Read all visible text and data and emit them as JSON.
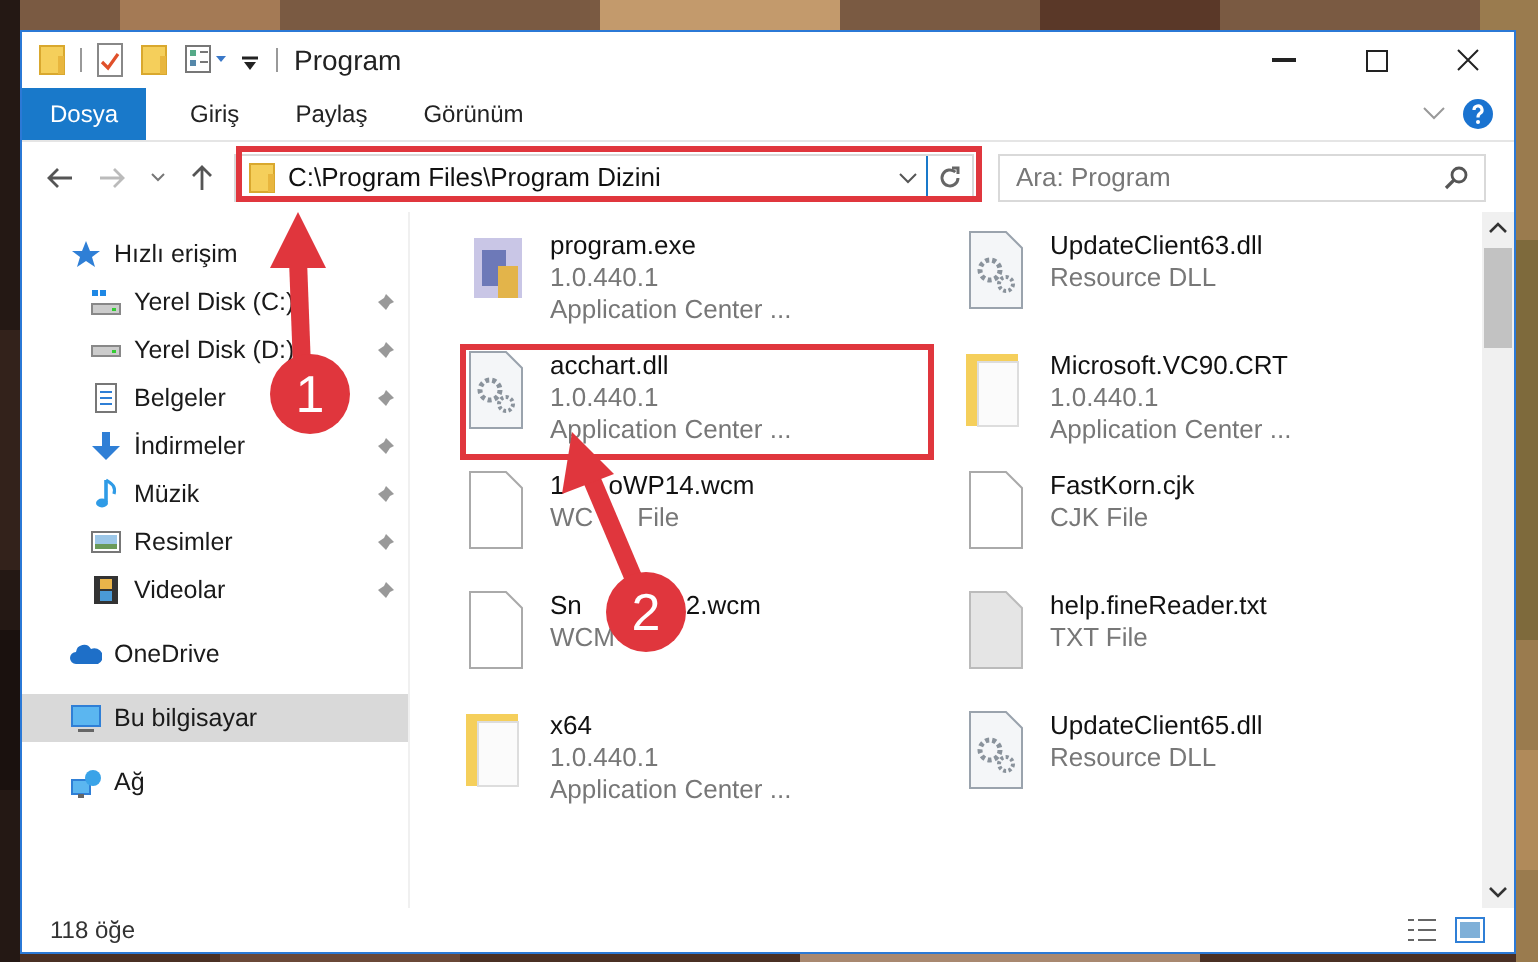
{
  "window": {
    "title": "Program"
  },
  "ribbon_tabs": [
    {
      "label": "Dosya",
      "selected": true
    },
    {
      "label": "Giriş",
      "selected": false
    },
    {
      "label": "Paylaş",
      "selected": false
    },
    {
      "label": "Görünüm",
      "selected": false
    }
  ],
  "address": {
    "path": "C:\\Program Files\\Program Dizini"
  },
  "search": {
    "placeholder": "Ara: Program"
  },
  "sidebar": {
    "items": [
      {
        "label": "Hızlı erişim",
        "kind": "star",
        "selected": false,
        "children": [
          {
            "label": "Yerel Disk (C:)",
            "kind": "windrive",
            "pinned": true
          },
          {
            "label": "Yerel Disk (D:)",
            "kind": "drive",
            "pinned": true
          },
          {
            "label": "Belgeler",
            "kind": "document",
            "pinned": true
          },
          {
            "label": "İndirmeler",
            "kind": "download",
            "pinned": true
          },
          {
            "label": "Müzik",
            "kind": "music",
            "pinned": true
          },
          {
            "label": "Resimler",
            "kind": "pictures",
            "pinned": true
          },
          {
            "label": "Videolar",
            "kind": "film",
            "pinned": true
          }
        ]
      },
      {
        "label": "OneDrive",
        "kind": "cloud",
        "selected": false
      },
      {
        "label": "Bu bilgisayar",
        "kind": "computer",
        "selected": true
      },
      {
        "label": "Ağ",
        "kind": "network",
        "selected": false
      }
    ]
  },
  "files": [
    {
      "name_parts": [
        "program.exe"
      ],
      "lines": [
        [
          "1.0.440.1"
        ],
        [
          "Application Center ..."
        ]
      ],
      "kind": "program"
    },
    {
      "name_parts": [
        "acchart.dll"
      ],
      "lines": [
        [
          "1.0.440.1"
        ],
        [
          "Application Center ..."
        ]
      ],
      "kind": "library"
    },
    {
      "name_parts": [
        "1",
        "oWP14.wcm"
      ],
      "lines": [
        [
          "WC",
          "File"
        ]
      ],
      "kind": "blank"
    },
    {
      "name_parts": [
        "Sn",
        "2.wcm"
      ],
      "lines": [
        [
          "WCM"
        ]
      ],
      "kind": "blank"
    },
    {
      "name_parts": [
        "x64"
      ],
      "lines": [
        [
          "1.0.440.1"
        ],
        [
          "Application Center ..."
        ]
      ],
      "kind": "folder"
    },
    {
      "name_parts": [
        "UpdateClient63.dll"
      ],
      "lines": [
        [
          "Resource DLL"
        ]
      ],
      "kind": "library"
    },
    {
      "name_parts": [
        "Microsoft.VC90.CRT"
      ],
      "lines": [
        [
          "1.0.440.1"
        ],
        [
          "Application Center ..."
        ]
      ],
      "kind": "folder"
    },
    {
      "name_parts": [
        "FastKorn.cjk"
      ],
      "lines": [
        [
          "CJK File"
        ]
      ],
      "kind": "blank"
    },
    {
      "name_parts": [
        "help.fineReader.txt"
      ],
      "lines": [
        [
          "TXT File"
        ]
      ],
      "kind": "text"
    },
    {
      "name_parts": [
        "UpdateClient65.dll"
      ],
      "lines": [
        [
          "Resource DLL"
        ]
      ],
      "kind": "library"
    }
  ],
  "status_bar": {
    "count": "118 öğe"
  },
  "annotations": [
    {
      "number": "1"
    },
    {
      "number": "2"
    }
  ]
}
